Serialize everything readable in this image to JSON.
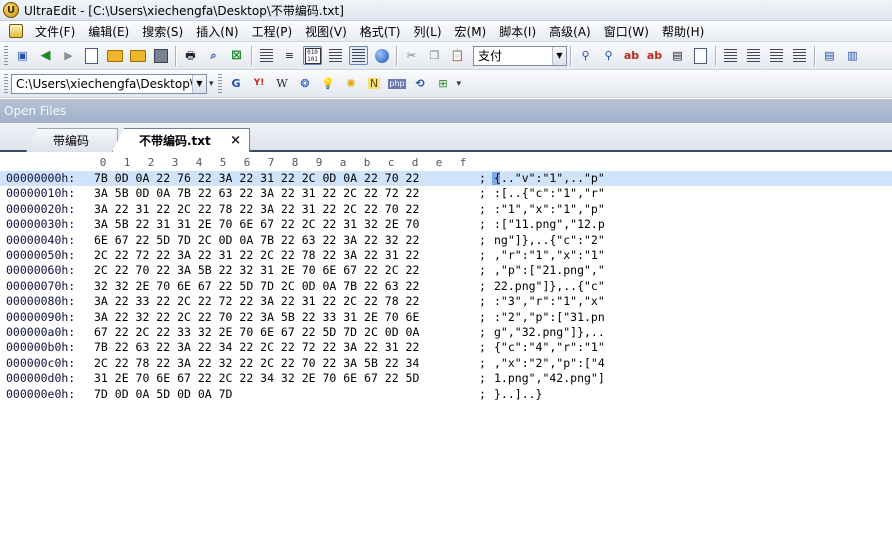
{
  "window": {
    "title": "UltraEdit - [C:\\Users\\xiechengfa\\Desktop\\不带编码.txt]"
  },
  "menu": [
    "文件(F)",
    "编辑(E)",
    "搜索(S)",
    "插入(N)",
    "工程(P)",
    "视图(V)",
    "格式(T)",
    "列(L)",
    "宏(M)",
    "脚本(I)",
    "高级(A)",
    "窗口(W)",
    "帮助(H)"
  ],
  "toolbar": {
    "encoding_combo": "支付",
    "path_combo": "C:\\Users\\xiechengfa\\Desktop\\"
  },
  "quicklinks": [
    "G",
    "Y!",
    "W",
    "N",
    "php"
  ],
  "open_files_label": "Open Files",
  "tabs": [
    {
      "label": "带编码",
      "active": false
    },
    {
      "label": "不带编码.txt",
      "active": true
    }
  ],
  "hex": {
    "columns": [
      "0",
      "1",
      "2",
      "3",
      "4",
      "5",
      "6",
      "7",
      "8",
      "9",
      "a",
      "b",
      "c",
      "d",
      "e",
      "f"
    ],
    "rows": [
      {
        "addr": "00000000h:",
        "hex": "7B 0D 0A 22 76 22 3A 22 31 22 2C 0D 0A 22 70 22",
        "ascii": "{..\"v\":\"1\",..\"p\"",
        "selected": true
      },
      {
        "addr": "00000010h:",
        "hex": "3A 5B 0D 0A 7B 22 63 22 3A 22 31 22 2C 22 72 22",
        "ascii": ":[..{\"c\":\"1\",\"r\""
      },
      {
        "addr": "00000020h:",
        "hex": "3A 22 31 22 2C 22 78 22 3A 22 31 22 2C 22 70 22",
        "ascii": ":\"1\",\"x\":\"1\",\"p\""
      },
      {
        "addr": "00000030h:",
        "hex": "3A 5B 22 31 31 2E 70 6E 67 22 2C 22 31 32 2E 70",
        "ascii": ":[\"11.png\",\"12.p"
      },
      {
        "addr": "00000040h:",
        "hex": "6E 67 22 5D 7D 2C 0D 0A 7B 22 63 22 3A 22 32 22",
        "ascii": "ng\"]},..{\"c\":\"2\""
      },
      {
        "addr": "00000050h:",
        "hex": "2C 22 72 22 3A 22 31 22 2C 22 78 22 3A 22 31 22",
        "ascii": ",\"r\":\"1\",\"x\":\"1\""
      },
      {
        "addr": "00000060h:",
        "hex": "2C 22 70 22 3A 5B 22 32 31 2E 70 6E 67 22 2C 22",
        "ascii": ",\"p\":[\"21.png\",\""
      },
      {
        "addr": "00000070h:",
        "hex": "32 32 2E 70 6E 67 22 5D 7D 2C 0D 0A 7B 22 63 22",
        "ascii": "22.png\"]},..{\"c\""
      },
      {
        "addr": "00000080h:",
        "hex": "3A 22 33 22 2C 22 72 22 3A 22 31 22 2C 22 78 22",
        "ascii": ":\"3\",\"r\":\"1\",\"x\""
      },
      {
        "addr": "00000090h:",
        "hex": "3A 22 32 22 2C 22 70 22 3A 5B 22 33 31 2E 70 6E",
        "ascii": ":\"2\",\"p\":[\"31.pn"
      },
      {
        "addr": "000000a0h:",
        "hex": "67 22 2C 22 33 32 2E 70 6E 67 22 5D 7D 2C 0D 0A",
        "ascii": "g\",\"32.png\"]},.."
      },
      {
        "addr": "000000b0h:",
        "hex": "7B 22 63 22 3A 22 34 22 2C 22 72 22 3A 22 31 22",
        "ascii": "{\"c\":\"4\",\"r\":\"1\""
      },
      {
        "addr": "000000c0h:",
        "hex": "2C 22 78 22 3A 22 32 22 2C 22 70 22 3A 5B 22 34",
        "ascii": ",\"x\":\"2\",\"p\":[\"4"
      },
      {
        "addr": "000000d0h:",
        "hex": "31 2E 70 6E 67 22 2C 22 34 32 2E 70 6E 67 22 5D",
        "ascii": "1.png\",\"42.png\"]"
      },
      {
        "addr": "000000e0h:",
        "hex": "7D 0D 0A 5D 0D 0A 7D",
        "ascii": "}..]..}"
      }
    ]
  }
}
